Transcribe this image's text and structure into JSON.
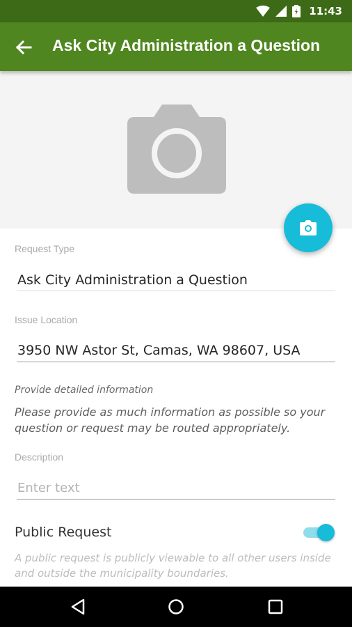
{
  "status_bar": {
    "time": "11:43",
    "icons": [
      "wifi-icon",
      "signal-icon",
      "battery-icon"
    ]
  },
  "app_bar": {
    "title": "Ask City Administration a Question",
    "back_icon": "arrow-left-icon"
  },
  "photo": {
    "placeholder_icon": "camera-icon",
    "fab_icon": "camera-icon"
  },
  "form": {
    "request_type": {
      "label": "Request Type",
      "value": "Ask City Administration a Question"
    },
    "issue_location": {
      "label": "Issue Location",
      "value": "3950 NW Astor St, Camas, WA 98607, USA"
    },
    "details": {
      "label": "Provide detailed information",
      "text": "Please provide as much information as possible so your question or request may be routed appropriately."
    },
    "description": {
      "label": "Description",
      "placeholder": "Enter text"
    },
    "public_request": {
      "label": "Public Request",
      "enabled": true,
      "note": "A public request is publicly viewable to all other users inside and outside the municipality boundaries."
    }
  },
  "nav_bar": {
    "icons": [
      "back-triangle-icon",
      "home-circle-icon",
      "recents-square-icon"
    ]
  },
  "colors": {
    "status_bar": "#3c6a16",
    "app_bar": "#4f861f",
    "accent": "#16bcd8"
  }
}
